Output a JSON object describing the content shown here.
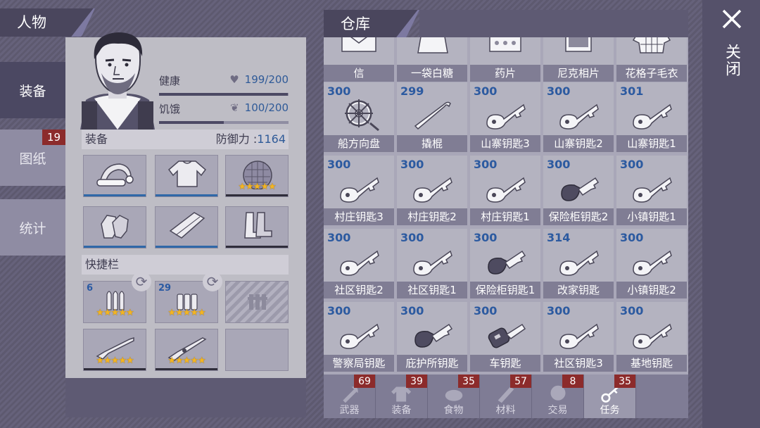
{
  "character": {
    "header": "人物",
    "tabs": [
      {
        "label": "装备"
      },
      {
        "label": "图纸",
        "badge": "19"
      },
      {
        "label": "统计"
      }
    ],
    "stats": [
      {
        "label": "健康",
        "value": "199/200",
        "icon": "heart-icon",
        "fill": 0.995
      },
      {
        "label": "饥饿",
        "value": "100/200",
        "icon": "stomach-icon",
        "fill": 0.5
      }
    ],
    "equipment": {
      "label": "装备",
      "defense_label": "防御力 :",
      "defense_value": "1164",
      "slots": [
        {
          "icon": "santa-hat-icon",
          "stars": ""
        },
        {
          "icon": "sweater-icon",
          "stars": ""
        },
        {
          "icon": "turtle-shell-icon",
          "stars": "★★★★★"
        },
        {
          "icon": "gloves-icon",
          "stars": ""
        },
        {
          "icon": "pants-icon",
          "stars": ""
        },
        {
          "icon": "boots-icon",
          "stars": ""
        }
      ]
    },
    "quickbar": {
      "label": "快捷栏",
      "slots": [
        {
          "icon": "rifle-ammo-icon",
          "qty": "6",
          "stars": "★★★★★"
        },
        {
          "icon": "shotgun-shells-icon",
          "qty": "29",
          "stars": "★★★★★"
        },
        {
          "icon": "locked-slot-icon",
          "qty": "",
          "stars": ""
        },
        {
          "icon": "hunting-rifle-icon",
          "qty": "",
          "stars": "★★★★★"
        },
        {
          "icon": "shotgun-icon",
          "qty": "",
          "stars": "★★★★★"
        },
        {
          "icon": "empty-slot",
          "qty": "",
          "stars": ""
        }
      ]
    }
  },
  "warehouse": {
    "header": "仓库",
    "top_row": [
      {
        "label": "信",
        "icon": "letter-icon"
      },
      {
        "label": "一袋白糖",
        "icon": "sugar-bag-icon"
      },
      {
        "label": "药片",
        "icon": "pills-icon"
      },
      {
        "label": "尼克相片",
        "icon": "photo-icon"
      },
      {
        "label": "花格子毛衣",
        "icon": "plaid-sweater-icon"
      }
    ],
    "items": [
      {
        "qty": "300",
        "label": "船方向盘",
        "icon": "ship-wheel-icon"
      },
      {
        "qty": "299",
        "label": "撬棍",
        "icon": "crowbar-icon"
      },
      {
        "qty": "300",
        "label": "山寨钥匙3",
        "icon": "key-icon"
      },
      {
        "qty": "300",
        "label": "山寨钥匙2",
        "icon": "key-icon"
      },
      {
        "qty": "301",
        "label": "山寨钥匙1",
        "icon": "key-icon"
      },
      {
        "qty": "300",
        "label": "村庄钥匙3",
        "icon": "key-icon"
      },
      {
        "qty": "300",
        "label": "村庄钥匙2",
        "icon": "key-icon"
      },
      {
        "qty": "300",
        "label": "村庄钥匙1",
        "icon": "key-icon"
      },
      {
        "qty": "300",
        "label": "保险柜钥匙2",
        "icon": "safe-key-icon"
      },
      {
        "qty": "300",
        "label": "小镇钥匙1",
        "icon": "key-icon"
      },
      {
        "qty": "300",
        "label": "社区钥匙2",
        "icon": "key-icon"
      },
      {
        "qty": "300",
        "label": "社区钥匙1",
        "icon": "key-icon"
      },
      {
        "qty": "300",
        "label": "保险柜钥匙1",
        "icon": "safe-key-icon"
      },
      {
        "qty": "314",
        "label": "改家钥匙",
        "icon": "key-icon"
      },
      {
        "qty": "300",
        "label": "小镇钥匙2",
        "icon": "key-icon"
      },
      {
        "qty": "300",
        "label": "警察局钥匙",
        "icon": "key-icon"
      },
      {
        "qty": "300",
        "label": "庇护所钥匙",
        "icon": "safe-key-icon"
      },
      {
        "qty": "300",
        "label": "车钥匙",
        "icon": "car-key-icon"
      },
      {
        "qty": "300",
        "label": "社区钥匙3",
        "icon": "key-icon"
      },
      {
        "qty": "300",
        "label": "基地钥匙",
        "icon": "key-icon"
      }
    ],
    "categories": [
      {
        "label": "武器",
        "badge": "69",
        "icon": "axe-icon"
      },
      {
        "label": "装备",
        "badge": "39",
        "icon": "shirt-icon"
      },
      {
        "label": "食物",
        "badge": "35",
        "icon": "food-icon"
      },
      {
        "label": "材料",
        "badge": "57",
        "icon": "materials-icon"
      },
      {
        "label": "交易",
        "badge": "8",
        "icon": "trade-icon"
      },
      {
        "label": "任务",
        "badge": "35",
        "icon": "quest-key-icon",
        "active": true
      }
    ]
  },
  "close": {
    "label": "关闭"
  }
}
